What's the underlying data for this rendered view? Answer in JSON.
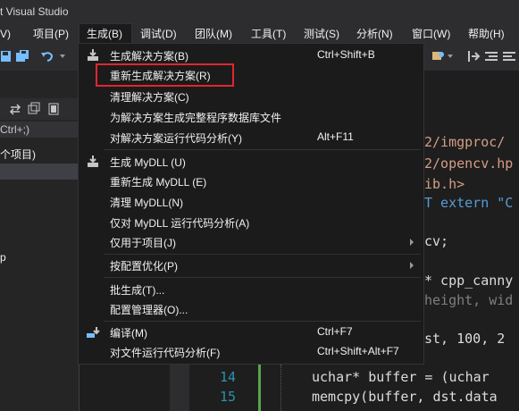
{
  "window": {
    "title_fragment": "t Visual Studio"
  },
  "menubar": {
    "items": [
      {
        "label": "V)"
      },
      {
        "label": "项目(P)"
      },
      {
        "label": "生成(B)"
      },
      {
        "label": "调试(D)"
      },
      {
        "label": "团队(M)"
      },
      {
        "label": "工具(T)"
      },
      {
        "label": "测试(S)"
      },
      {
        "label": "分析(N)"
      },
      {
        "label": "窗口(W)"
      },
      {
        "label": "帮助(H)"
      }
    ]
  },
  "solution_panel": {
    "search_text": "Ctrl+;)",
    "row1": "个项目)",
    "row2": "p"
  },
  "build_menu": {
    "items": [
      {
        "label": "生成解决方案(B)",
        "shortcut": "Ctrl+Shift+B",
        "icon": "build-solution-icon"
      },
      {
        "label": "重新生成解决方案(R)",
        "shortcut": "",
        "highlighted": true
      },
      {
        "label": "清理解决方案(C)",
        "shortcut": ""
      },
      {
        "label": "为解决方案生成完整程序数据库文件",
        "shortcut": ""
      },
      {
        "label": "对解决方案运行代码分析(Y)",
        "shortcut": "Alt+F11"
      },
      {
        "label": "生成 MyDLL (U)",
        "shortcut": "",
        "icon": "build-project-icon"
      },
      {
        "label": "重新生成 MyDLL (E)",
        "shortcut": ""
      },
      {
        "label": "清理 MyDLL(N)",
        "shortcut": ""
      },
      {
        "label": "仅对 MyDLL 运行代码分析(A)",
        "shortcut": ""
      },
      {
        "label": "仅用于项目(J)",
        "shortcut": "",
        "submenu": true
      },
      {
        "label": "按配置优化(P)",
        "shortcut": "",
        "submenu": true
      },
      {
        "label": "批生成(T)...",
        "shortcut": ""
      },
      {
        "label": "配置管理器(O)...",
        "shortcut": ""
      },
      {
        "label": "编译(M)",
        "shortcut": "Ctrl+F7",
        "icon": "compile-icon"
      },
      {
        "label": "对文件运行代码分析(F)",
        "shortcut": "Ctrl+Shift+Alt+F7"
      }
    ]
  },
  "editor": {
    "visible_fragments": [
      "2/imgproc/",
      "2/opencv.hp",
      "ib.h>",
      "T extern \"C",
      "cv;",
      "* cpp_canny",
      "height, wid",
      "st, 100, 2"
    ],
    "lines": [
      {
        "number": "14",
        "code": "uchar* buffer = (uchar"
      },
      {
        "number": "15",
        "code": "memcpy(buffer, dst.data"
      }
    ]
  },
  "colors": {
    "highlight_border": "#e0272c",
    "menu_bg": "#1b1b1c",
    "chrome_bg": "#2d2d30"
  }
}
